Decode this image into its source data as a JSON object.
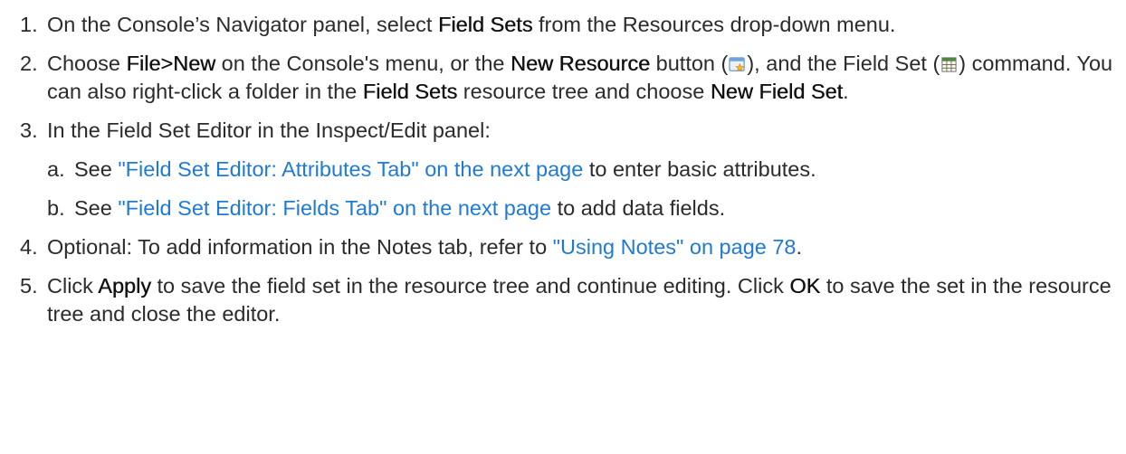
{
  "steps": [
    {
      "num": "1.",
      "t1": "On the Console’s Navigator panel, select ",
      "b1": "Field Sets",
      "t2": " from the Resources drop-down menu."
    },
    {
      "num": "2.",
      "t1": "Choose ",
      "b1": "File>New",
      "t2": " on the Console's menu, or the ",
      "b2": "New Resource",
      "t3": " button (",
      "icon1": "new-resource-icon",
      "t4": "), and the Field Set (",
      "icon2": "field-set-grid-icon",
      "t5": ") command. You can also right-click a folder in the ",
      "b3": "Field Sets",
      "t6": " resource tree and choose ",
      "b4": "New Field Set",
      "t7": "."
    },
    {
      "num": "3.",
      "t1": "In the Field Set Editor in the Inspect/Edit panel:",
      "sub": [
        {
          "num": "a.",
          "t1": "See ",
          "link": "\"Field Set Editor: Attributes Tab\" on the next page",
          "t2": " to enter basic attributes."
        },
        {
          "num": "b.",
          "t1": "See ",
          "link": "\"Field Set Editor: Fields Tab\" on the next page",
          "t2": " to add data fields."
        }
      ]
    },
    {
      "num": "4.",
      "t1": "Optional: To add information in the Notes tab, refer to ",
      "link": "\"Using Notes\" on page 78",
      "t2": "."
    },
    {
      "num": "5.",
      "t1": "Click ",
      "b1": "Apply",
      "t2": " to save the field set in the resource tree and continue editing. Click ",
      "b2": "OK",
      "t3": " to save the set in the resource tree and close the editor."
    }
  ],
  "colors": {
    "text": "#2b2b2b",
    "link": "#1f7ad6"
  }
}
